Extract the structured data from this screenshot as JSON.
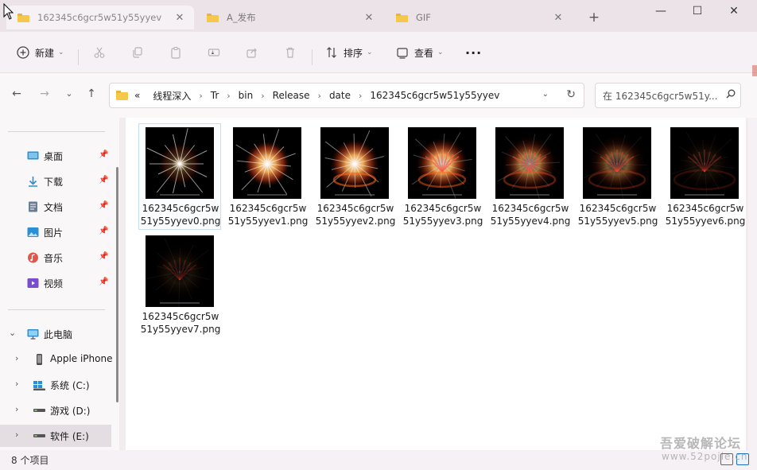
{
  "tabs": [
    {
      "title": "162345c6gcr5w51y55yyev",
      "active": true
    },
    {
      "title": "A_发布",
      "active": false
    },
    {
      "title": "GIF",
      "active": false
    }
  ],
  "newtab_symbol": "+",
  "window_controls": {
    "minimize": "—",
    "maximize": "☐",
    "close": "✕"
  },
  "toolbar": {
    "new_label": "新建",
    "sort_label": "排序",
    "view_label": "查看",
    "more_symbol": "···"
  },
  "address": {
    "overflow": "«",
    "crumbs": [
      "线程深入",
      "Tr",
      "bin",
      "Release",
      "date",
      "162345c6gcr5w51y55yyev"
    ],
    "separator": "›"
  },
  "search": {
    "placeholder": "在 162345c6gcr5w51y..."
  },
  "sidebar": {
    "quick_access": [
      {
        "label": "桌面",
        "icon": "desktop-icon",
        "color": "#2b8fd6"
      },
      {
        "label": "下载",
        "icon": "download-icon",
        "color": "#2b8fd6"
      },
      {
        "label": "文档",
        "icon": "document-icon",
        "color": "#6b7d92"
      },
      {
        "label": "图片",
        "icon": "picture-icon",
        "color": "#2b8fd6"
      },
      {
        "label": "音乐",
        "icon": "music-icon",
        "color": "#e0584a"
      },
      {
        "label": "视频",
        "icon": "video-icon",
        "color": "#7b4bd0"
      }
    ],
    "this_pc": "此电脑",
    "devices": [
      {
        "label": "Apple iPhone",
        "icon": "phone-icon"
      },
      {
        "label": "系统 (C:)",
        "icon": "windows-drive-icon"
      },
      {
        "label": "游戏 (D:)",
        "icon": "drive-icon"
      },
      {
        "label": "软件 (E:)",
        "icon": "drive-icon"
      }
    ]
  },
  "files": [
    {
      "name": "162345c6gcr5w51y55yyev0.png",
      "frame": 0
    },
    {
      "name": "162345c6gcr5w51y55yyev1.png",
      "frame": 1
    },
    {
      "name": "162345c6gcr5w51y55yyev2.png",
      "frame": 2
    },
    {
      "name": "162345c6gcr5w51y55yyev3.png",
      "frame": 3
    },
    {
      "name": "162345c6gcr5w51y55yyev4.png",
      "frame": 4
    },
    {
      "name": "162345c6gcr5w51y55yyev5.png",
      "frame": 5
    },
    {
      "name": "162345c6gcr5w51y55yyev6.png",
      "frame": 6
    },
    {
      "name": "162345c6gcr5w51y55yyev7.png",
      "frame": 7
    }
  ],
  "status": {
    "item_count": "8 个项目"
  },
  "watermark": {
    "line1": "吾爱破解论坛",
    "line2": "www.52pojie.cn"
  },
  "colors": {
    "accent": "#1b6ec2",
    "folder": "#f5c84c"
  }
}
